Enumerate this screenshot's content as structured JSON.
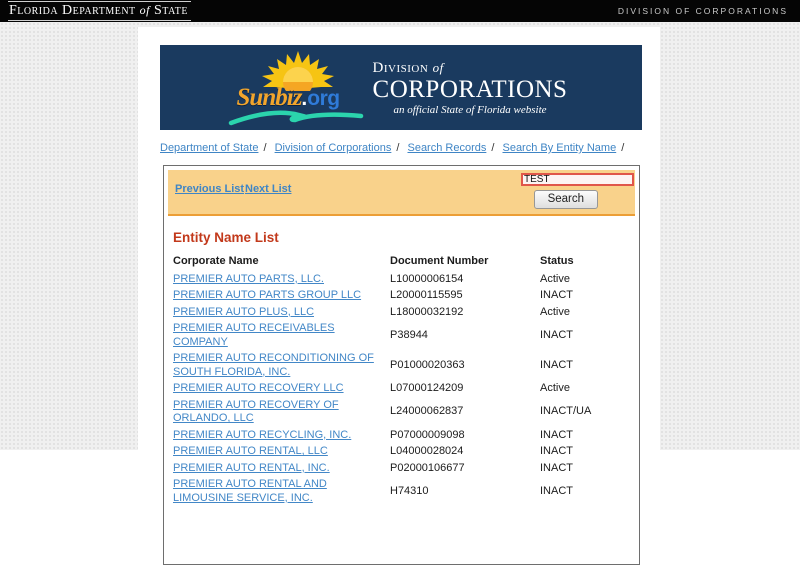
{
  "topbar": {
    "dos_part1": "Florida Department",
    "dos_of": "of",
    "dos_part2": "State",
    "right_label": "Division of Corporations"
  },
  "banner": {
    "bg_color": "#1a3a5f",
    "sunbiz_word": "Sunbiz",
    "org_dot": ".",
    "org_word": "org",
    "division_word": "Division",
    "of_word": "of",
    "corporations_word": "CORPORATIONS",
    "tagline": "an official State of Florida website"
  },
  "breadcrumb": {
    "separator": "/",
    "items": [
      "Department of State",
      "Division of Corporations",
      "Search Records",
      "Search By Entity Name"
    ]
  },
  "listnav": {
    "previous_label": "Previous List",
    "next_label": "Next List"
  },
  "search": {
    "value": "TEST",
    "button_label": "Search"
  },
  "results": {
    "heading": "Entity Name List",
    "columns": [
      "Corporate Name",
      "Document Number",
      "Status"
    ],
    "rows": [
      {
        "name": "PREMIER AUTO PARTS, LLC.",
        "document": "L10000006154",
        "status": "Active"
      },
      {
        "name": "PREMIER AUTO PARTS GROUP LLC",
        "document": "L20000115595",
        "status": "INACT"
      },
      {
        "name": "PREMIER AUTO PLUS, LLC",
        "document": "L18000032192",
        "status": "Active"
      },
      {
        "name": "PREMIER AUTO RECEIVABLES COMPANY",
        "document": "P38944",
        "status": "INACT"
      },
      {
        "name": "PREMIER AUTO RECONDITIONING OF SOUTH FLORIDA, INC.",
        "document": "P01000020363",
        "status": "INACT"
      },
      {
        "name": "PREMIER AUTO RECOVERY LLC",
        "document": "L07000124209",
        "status": "Active"
      },
      {
        "name": "PREMIER AUTO RECOVERY OF ORLANDO, LLC",
        "document": "L24000062837",
        "status": "INACT/UA"
      },
      {
        "name": "PREMIER AUTO RECYCLING, INC.",
        "document": "P07000009098",
        "status": "INACT"
      },
      {
        "name": "PREMIER AUTO RENTAL, LLC",
        "document": "L04000028024",
        "status": "INACT"
      },
      {
        "name": "PREMIER AUTO RENTAL, INC.",
        "document": "P02000106677",
        "status": "INACT"
      },
      {
        "name": "PREMIER AUTO RENTAL AND LIMOUSINE SERVICE, INC.",
        "document": "H74310",
        "status": "INACT"
      }
    ]
  },
  "colors": {
    "banner_navy": "#1a3a5f",
    "listnav_orange": "#f9d28b",
    "listnav_border": "#ec9e36",
    "link_blue": "#3f85c5",
    "heading_red": "#c2391b",
    "search_border_red": "#e0564a"
  }
}
